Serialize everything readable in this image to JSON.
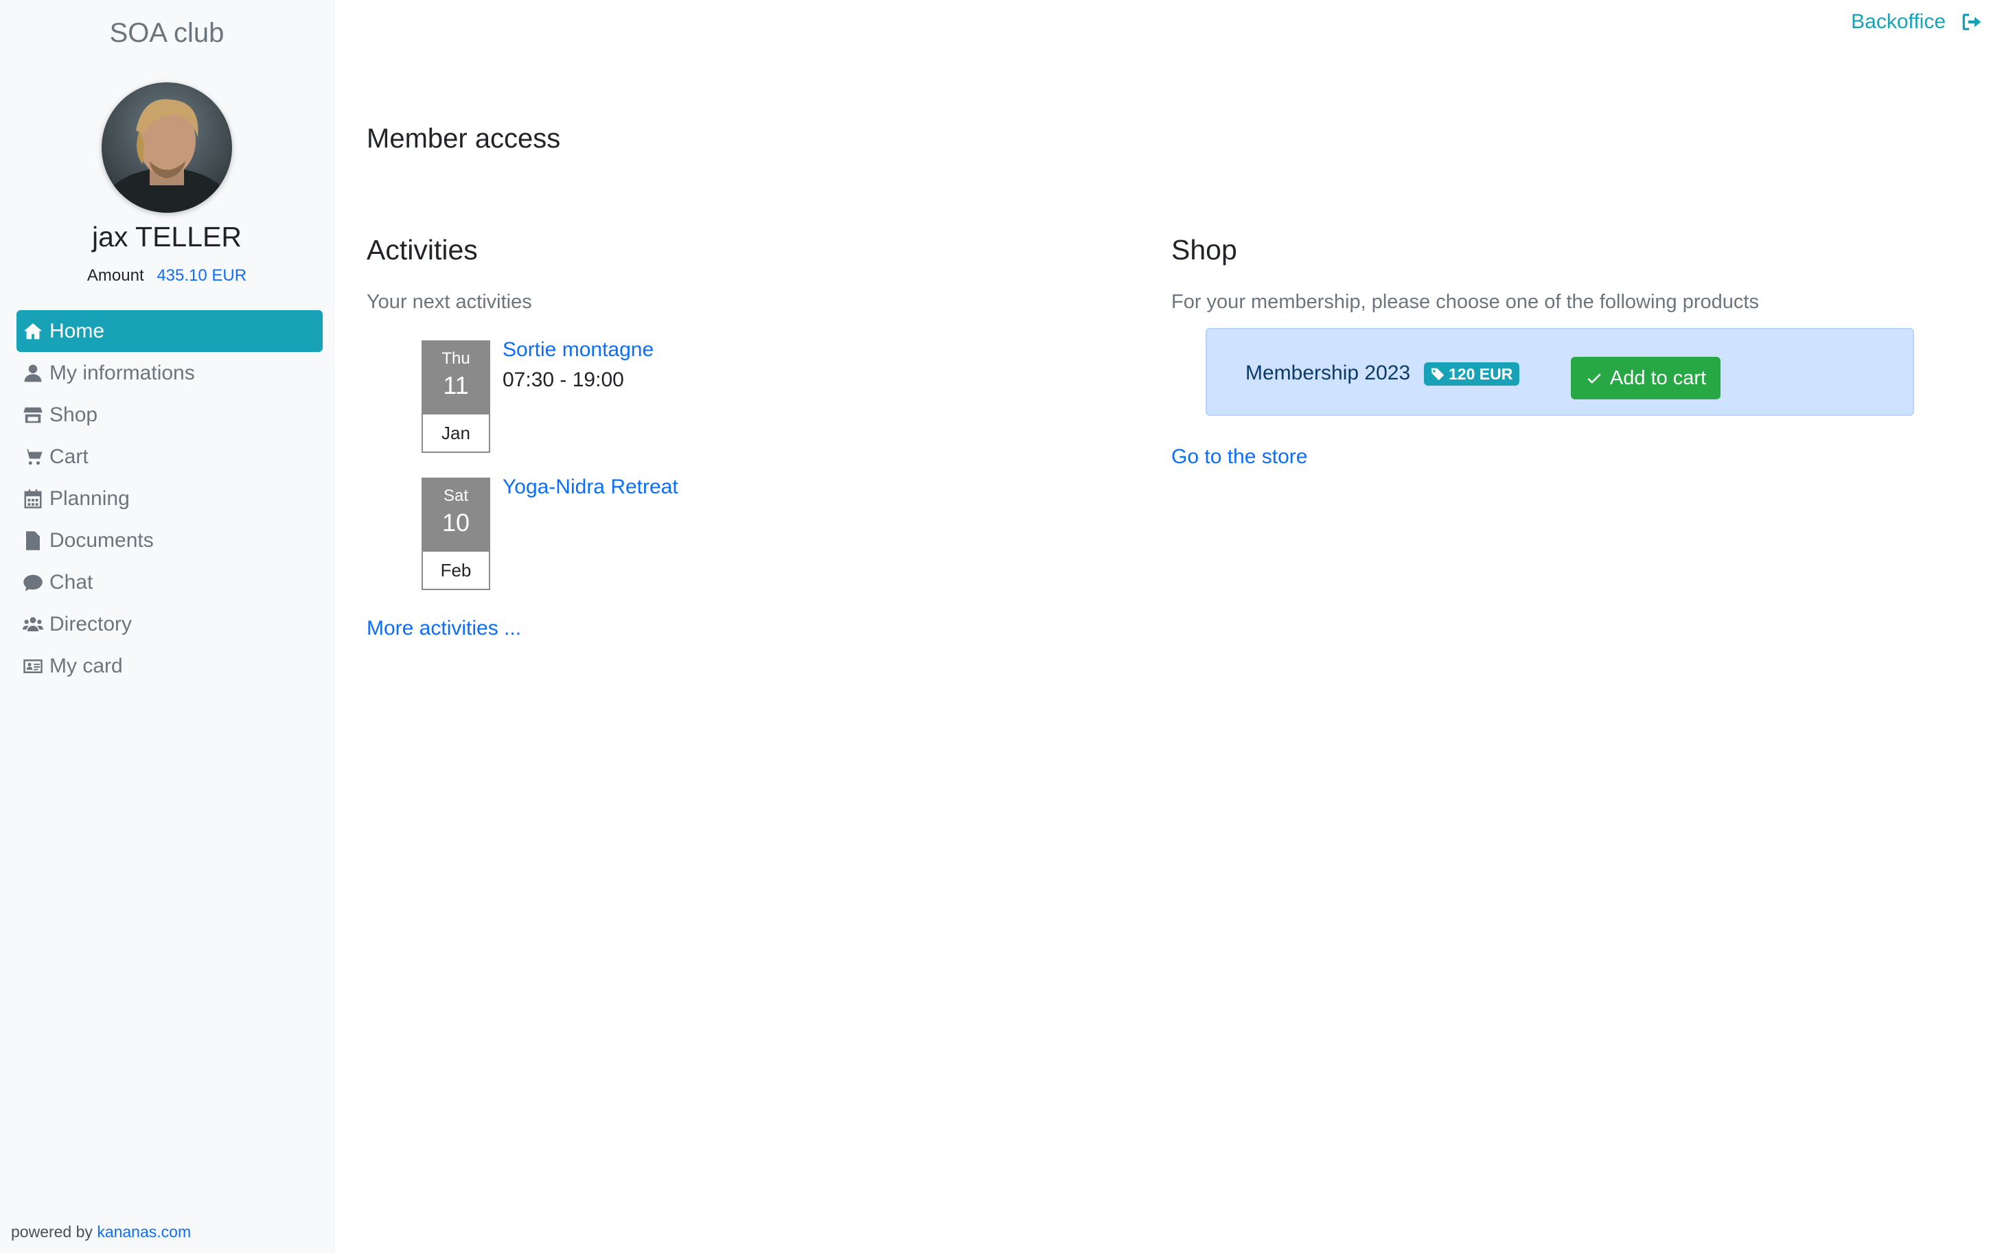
{
  "sidebar": {
    "brand": "SOA club",
    "user_name": "jax TELLER",
    "amount_label": "Amount",
    "amount_value": "435.10 EUR",
    "nav": [
      {
        "label": "Home",
        "icon": "home-icon",
        "active": true
      },
      {
        "label": "My informations",
        "icon": "user-icon"
      },
      {
        "label": "Shop",
        "icon": "store-icon"
      },
      {
        "label": "Cart",
        "icon": "cart-icon"
      },
      {
        "label": "Planning",
        "icon": "calendar-icon"
      },
      {
        "label": "Documents",
        "icon": "document-icon"
      },
      {
        "label": "Chat",
        "icon": "chat-icon"
      },
      {
        "label": "Directory",
        "icon": "users-icon"
      },
      {
        "label": "My card",
        "icon": "id-card-icon"
      }
    ],
    "powered_by": "powered by",
    "powered_link": "kananas.com"
  },
  "header": {
    "backoffice": "Backoffice",
    "logout_icon": "sign-out-icon"
  },
  "main": {
    "page_title": "Member access",
    "activities": {
      "title": "Activities",
      "subtitle": "Your next activities",
      "events": [
        {
          "dow": "Thu",
          "day": "11",
          "month": "Jan",
          "title": "Sortie montagne",
          "time": "07:30 - 19:00"
        },
        {
          "dow": "Sat",
          "day": "10",
          "month": "Feb",
          "title": "Yoga-Nidra Retreat",
          "time": ""
        }
      ],
      "more": "More activities ..."
    },
    "shop": {
      "title": "Shop",
      "subtitle": "For your membership, please choose one of the following products",
      "product": {
        "name": "Membership 2023",
        "price": "120 EUR",
        "button": "Add to cart"
      },
      "store_link": "Go to the store"
    }
  },
  "colors": {
    "accent": "#17a2b8",
    "link": "#0d6efd",
    "success": "#28a745",
    "product_bg": "#cfe2ff",
    "sidebar_bg": "#f8f9fa"
  }
}
